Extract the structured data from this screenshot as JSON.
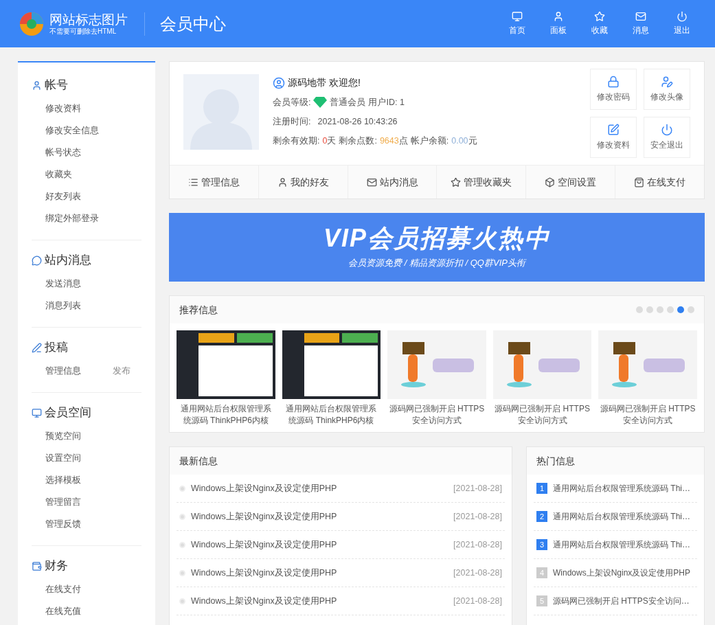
{
  "header": {
    "logo_text": "网站标志图片",
    "logo_subtext": "不需要可删除去HTML",
    "title": "会员中心",
    "nav": [
      {
        "kind": "monitor",
        "label": "首页"
      },
      {
        "kind": "user",
        "label": "面板"
      },
      {
        "kind": "star",
        "label": "收藏"
      },
      {
        "kind": "mail",
        "label": "消息"
      },
      {
        "kind": "power",
        "label": "退出"
      }
    ]
  },
  "sidebar": [
    {
      "kind": "user",
      "title": "帐号",
      "items": [
        {
          "label": "修改资料"
        },
        {
          "label": "修改安全信息"
        },
        {
          "label": "帐号状态"
        },
        {
          "label": "收藏夹"
        },
        {
          "label": "好友列表"
        },
        {
          "label": "绑定外部登录"
        }
      ]
    },
    {
      "kind": "chat",
      "title": "站内消息",
      "items": [
        {
          "label": "发送消息"
        },
        {
          "label": "消息列表"
        }
      ]
    },
    {
      "kind": "pen",
      "title": "投稿",
      "items": [
        {
          "label": "管理信息",
          "action": "发布"
        }
      ]
    },
    {
      "kind": "monitor",
      "title": "会员空间",
      "items": [
        {
          "label": "预览空间"
        },
        {
          "label": "设置空间"
        },
        {
          "label": "选择模板"
        },
        {
          "label": "管理留言"
        },
        {
          "label": "管理反馈"
        }
      ]
    },
    {
      "kind": "wallet",
      "title": "财务",
      "items": [
        {
          "label": "在线支付"
        },
        {
          "label": "在线充值"
        }
      ]
    }
  ],
  "profile": {
    "greeting": "源码地带 欢迎您!",
    "level_label": "会员等级:",
    "level": "普通会员",
    "user_id": "用户ID: 1",
    "register_label": "注册时间:",
    "register_time": "2021-08-26 10:43:26",
    "validity_label": "剩余有效期:",
    "validity": "0",
    "validity_unit": "天",
    "points_label": "剩余点数:",
    "points": "9643",
    "points_unit": "点",
    "balance_label": "帐户余额:",
    "balance": "0.00",
    "balance_unit": "元",
    "actions": [
      {
        "kind": "lock",
        "label": "修改密码"
      },
      {
        "kind": "user-edit",
        "label": "修改头像"
      },
      {
        "kind": "edit",
        "label": "修改资料"
      },
      {
        "kind": "power",
        "label": "安全退出"
      }
    ],
    "tabs": [
      {
        "kind": "list",
        "label": "管理信息"
      },
      {
        "kind": "user",
        "label": "我的好友"
      },
      {
        "kind": "mail",
        "label": "站内消息"
      },
      {
        "kind": "star",
        "label": "管理收藏夹"
      },
      {
        "kind": "box",
        "label": "空间设置"
      },
      {
        "kind": "bag",
        "label": "在线支付"
      }
    ]
  },
  "banner": {
    "title": "VIP会员招募火热中",
    "subtitle": "会员资源免费 / 精品资源折扣 / QQ群VIP头衔"
  },
  "recommend": {
    "title": "推荐信息",
    "dots": [
      {
        "selected": false
      },
      {
        "selected": false
      },
      {
        "selected": false
      },
      {
        "selected": false
      },
      {
        "selected": true
      },
      {
        "selected": false
      }
    ],
    "items": [
      {
        "kind": "screenshot",
        "title": "通用网站后台权限管理系统源码 ThinkPHP6内核"
      },
      {
        "kind": "screenshot",
        "title": "通用网站后台权限管理系统源码 ThinkPHP6内核"
      },
      {
        "kind": "no-image",
        "title": "源码网已强制开启 HTTPS 安全访问方式"
      },
      {
        "kind": "no-image",
        "title": "源码网已强制开启 HTTPS 安全访问方式"
      },
      {
        "kind": "no-image",
        "title": "源码网已强制开启 HTTPS 安全访问方式"
      }
    ]
  },
  "latest": {
    "title": "最新信息",
    "rows": [
      {
        "title": "Windows上架设Nginx及设定使用PHP",
        "date": "[2021-08-28]"
      },
      {
        "title": "Windows上架设Nginx及设定使用PHP",
        "date": "[2021-08-28]"
      },
      {
        "title": "Windows上架设Nginx及设定使用PHP",
        "date": "[2021-08-28]"
      },
      {
        "title": "Windows上架设Nginx及设定使用PHP",
        "date": "[2021-08-28]"
      },
      {
        "title": "Windows上架设Nginx及设定使用PHP",
        "date": "[2021-08-28]"
      }
    ]
  },
  "hot": {
    "title": "热门信息",
    "rows": [
      {
        "rank": "1",
        "color": "#2f7ff0",
        "title": "通用网站后台权限管理系统源码 Thi…"
      },
      {
        "rank": "2",
        "color": "#2f7ff0",
        "title": "通用网站后台权限管理系统源码 Thi…"
      },
      {
        "rank": "3",
        "color": "#2f7ff0",
        "title": "通用网站后台权限管理系统源码 Thi…"
      },
      {
        "rank": "4",
        "color": "#cccccc",
        "title": "Windows上架设Nginx及设定使用PHP"
      },
      {
        "rank": "5",
        "color": "#cccccc",
        "title": "源码网已强制开启 HTTPS安全访问…"
      }
    ]
  }
}
